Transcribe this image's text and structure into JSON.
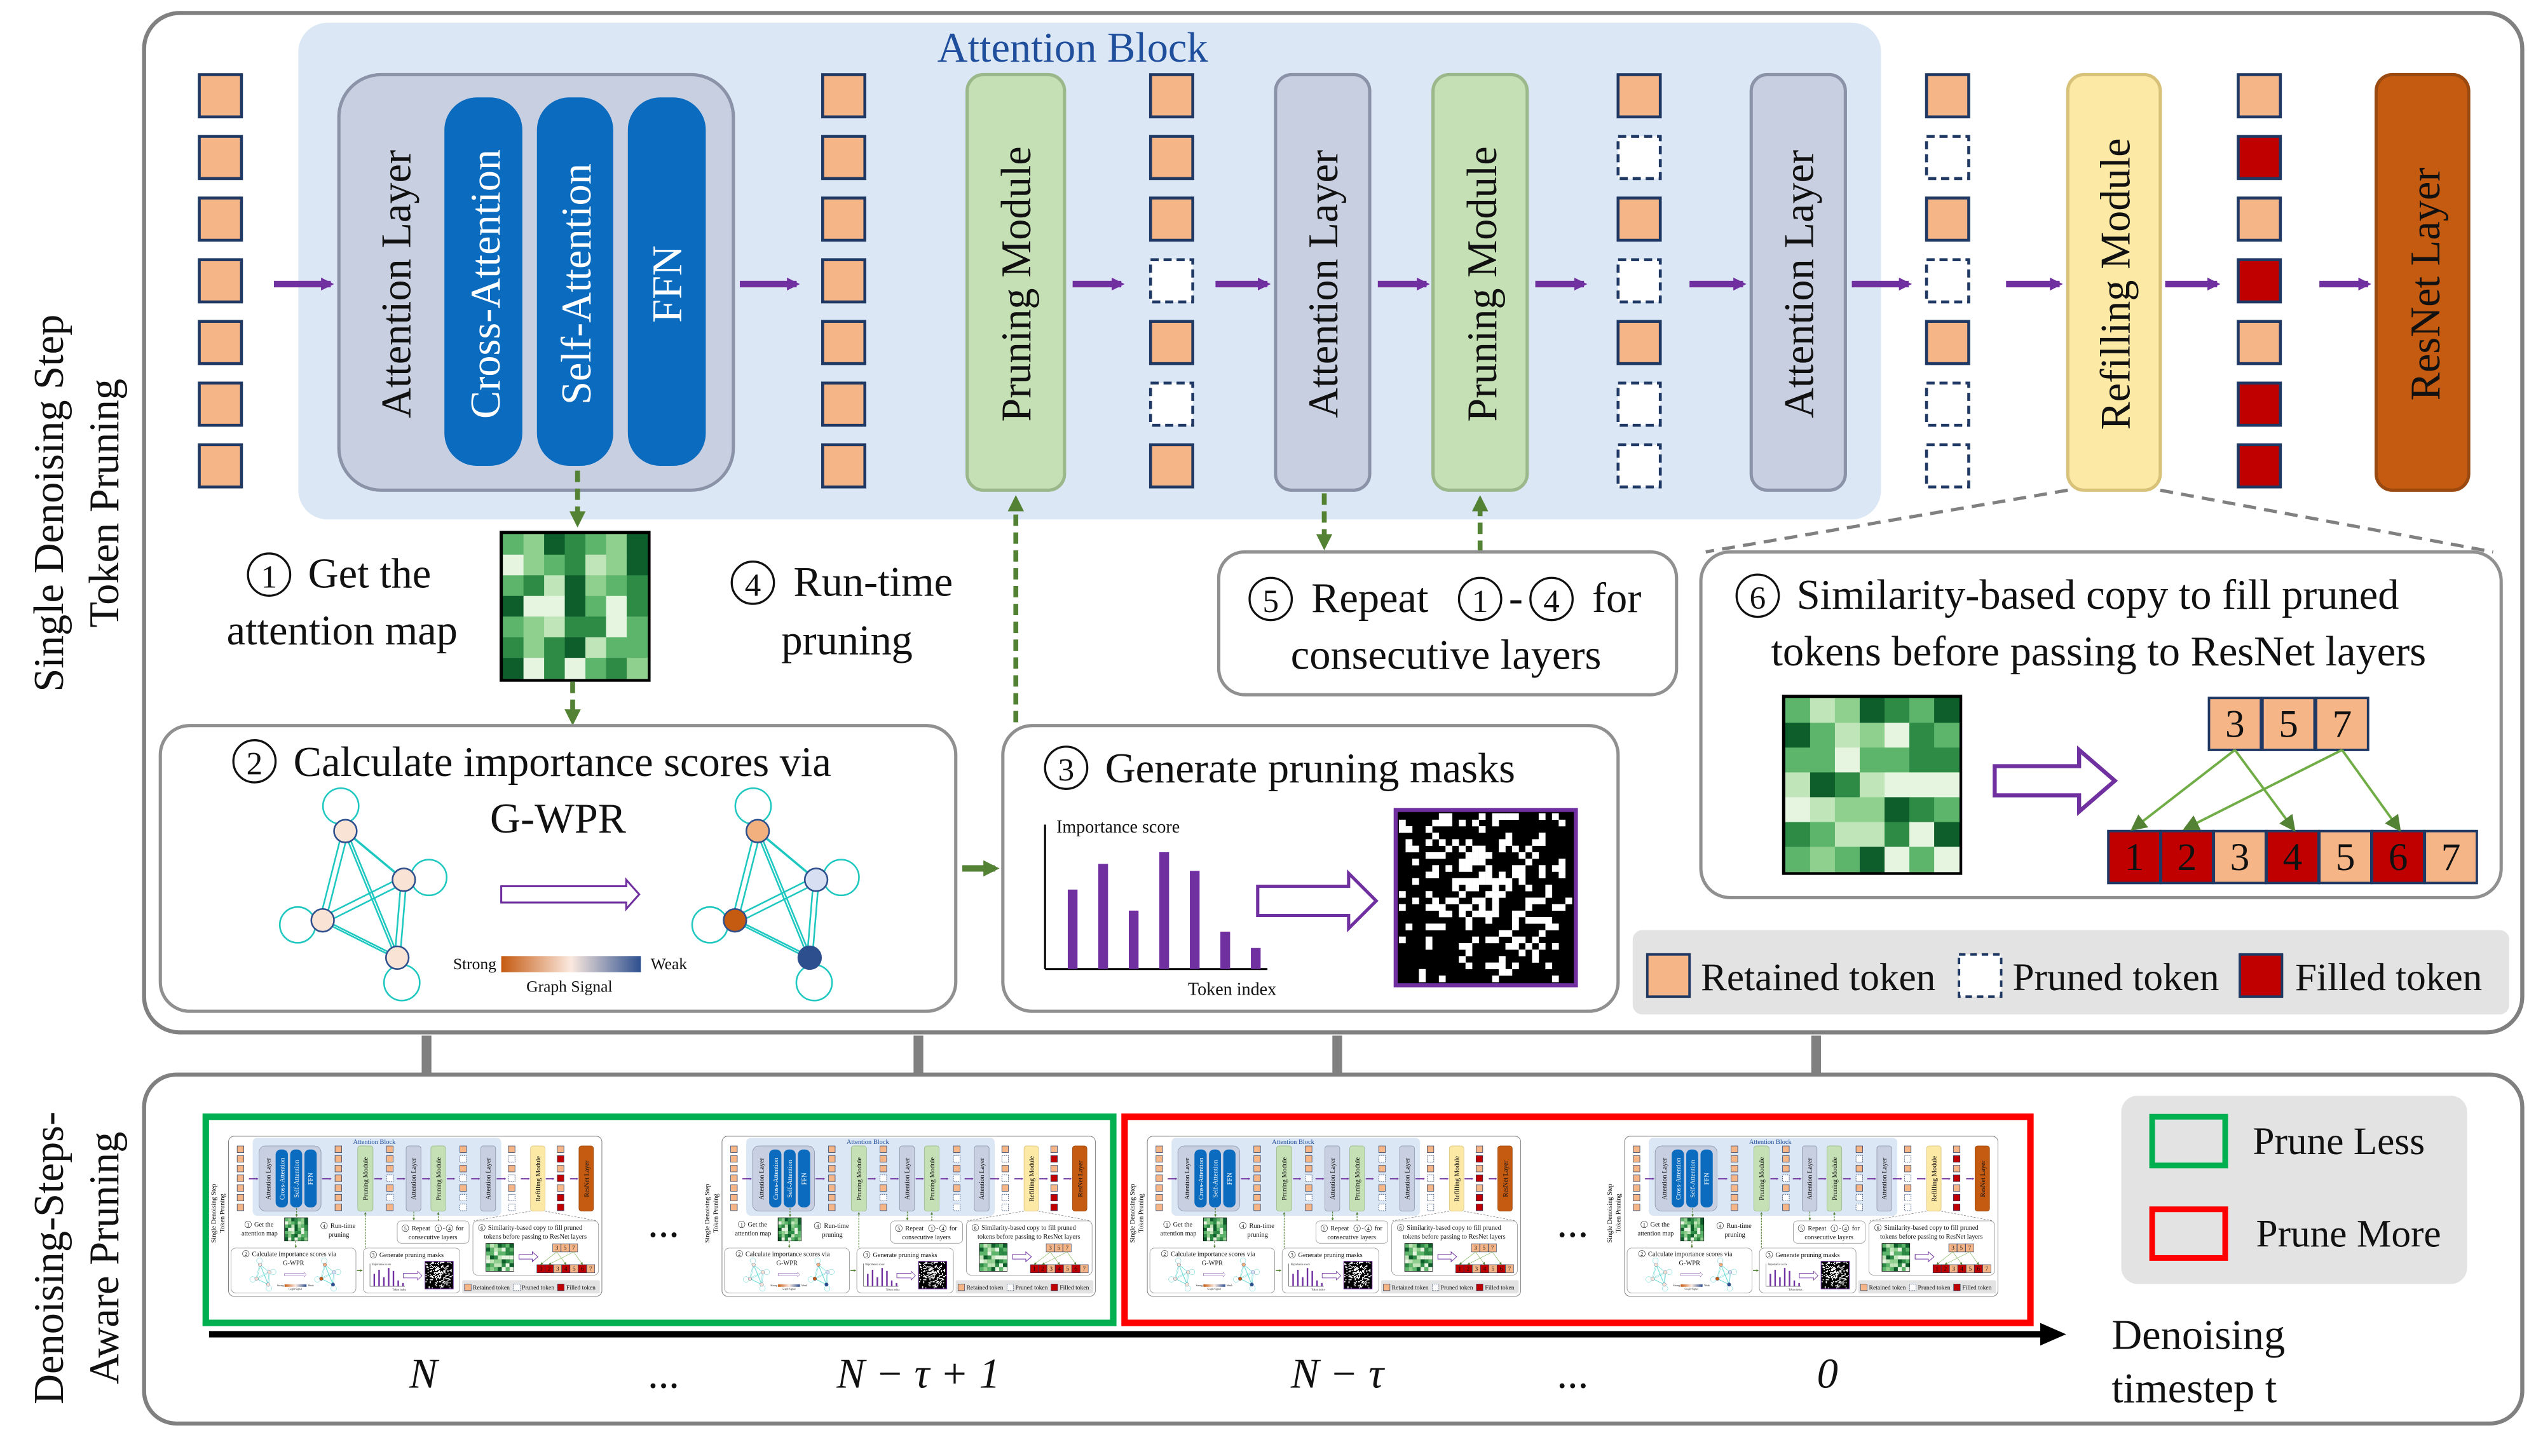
{
  "top_panel": {
    "side_label_line1": "Single Denoising Step",
    "side_label_line2": "Token Pruning",
    "attention_block_title": "Attention Block",
    "attention_layer": "Attention Layer",
    "cross_attention": "Cross-Attention",
    "self_attention": "Self-Attention",
    "ffn": "FFN",
    "pruning_module": "Pruning Module",
    "refilling_module": "Refilling Module",
    "resnet_layer": "ResNet Layer",
    "token_columns": [
      [
        "retained",
        "retained",
        "retained",
        "retained",
        "retained",
        "retained",
        "retained"
      ],
      [
        "retained",
        "retained",
        "retained",
        "retained",
        "retained",
        "retained",
        "retained"
      ],
      [
        "retained",
        "retained",
        "retained",
        "pruned",
        "retained",
        "pruned",
        "retained"
      ],
      [
        "retained",
        "pruned",
        "retained",
        "pruned",
        "retained",
        "pruned",
        "pruned"
      ],
      [
        "retained",
        "pruned",
        "retained",
        "pruned",
        "retained",
        "pruned",
        "pruned"
      ],
      [
        "retained",
        "filled",
        "retained",
        "filled",
        "retained",
        "filled",
        "filled"
      ]
    ],
    "step1": {
      "num": "1",
      "line1": "Get the",
      "line2": "attention map"
    },
    "step4": {
      "num": "4",
      "line1": "Run-time",
      "line2": "pruning"
    },
    "step5": {
      "num": "5",
      "line1a": "Repeat",
      "ref_a": "1",
      "dash": "-",
      "ref_b": "4",
      "line1b": "for",
      "line2": "consecutive layers"
    },
    "step6": {
      "num": "6",
      "line1": "Similarity-based copy to fill pruned",
      "line2": "tokens before passing to ResNet layers",
      "retained_tokens": [
        "3",
        "5",
        "7"
      ],
      "all_tokens": [
        {
          "label": "1",
          "state": "filled"
        },
        {
          "label": "2",
          "state": "filled"
        },
        {
          "label": "3",
          "state": "retained"
        },
        {
          "label": "4",
          "state": "filled"
        },
        {
          "label": "5",
          "state": "retained"
        },
        {
          "label": "6",
          "state": "filled"
        },
        {
          "label": "7",
          "state": "retained"
        }
      ],
      "copies": [
        {
          "from": "3",
          "to": "1"
        },
        {
          "from": "3",
          "to": "4"
        },
        {
          "from": "7",
          "to": "2"
        },
        {
          "from": "7",
          "to": "6"
        }
      ]
    },
    "step2": {
      "num": "2",
      "line1": "Calculate importance scores via",
      "line2": "G-WPR",
      "colorbar_strong": "Strong",
      "colorbar_weak": "Weak",
      "colorbar_title": "Graph Signal",
      "nodes_before": [
        "#f9e3d4",
        "#f9e3d4",
        "#f9e3d4",
        "#f9e3d4"
      ],
      "nodes_after": [
        "#f2b07e",
        "#d6e0f2",
        "#c55a11",
        "#2d4f8e"
      ]
    },
    "step3": {
      "num": "3",
      "title": "Generate pruning masks",
      "ylabel": "Importance score",
      "xlabel": "Token index",
      "scores": [
        0.68,
        0.9,
        0.5,
        1.0,
        0.84,
        0.32,
        0.18
      ]
    },
    "legend": {
      "retained": "Retained token",
      "pruned": "Pruned token",
      "filled": "Filled token"
    }
  },
  "bottom_panel": {
    "side_label_line1": "Denoising-Steps-",
    "side_label_line2": "Aware Pruning",
    "ellipsis": "...",
    "timesteps": [
      "N",
      "...",
      "N − τ + 1",
      "N − τ",
      "...",
      "0"
    ],
    "axis_label_line1": "Denoising",
    "axis_label_line2": "timestep t",
    "legend": {
      "prune_less": "Prune Less",
      "prune_more": "Prune More"
    }
  },
  "colors": {
    "retained": "#f6b586",
    "filled": "#c00000",
    "pruned_border": "#1f3864",
    "purple": "#7030a0",
    "green_arrow": "#548235",
    "attention_blue": "#0a6bbf",
    "attention_block_bg": "#dbe7f4",
    "layer_gray": "#c8cfe0",
    "pruning_green": "#c5e0b4",
    "refill_yellow": "#fde9a6",
    "resnet": "#c55a11",
    "prune_less": "#00b050",
    "prune_more": "#ff0000"
  }
}
